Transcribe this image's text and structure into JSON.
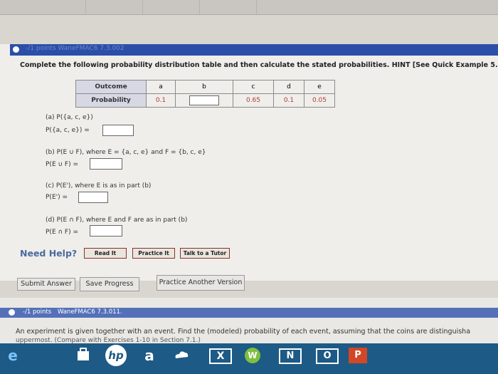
{
  "header": {
    "points_label": "-/1 points",
    "assignment_code": "WaneFMAC6 7.3.002"
  },
  "question": {
    "prompt": "Complete the following probability distribution table and then calculate the stated probabilities. HINT [See Quick Example 5.]",
    "table": {
      "outcome_label": "Outcome",
      "probability_label": "Probability",
      "outcomes": [
        "a",
        "b",
        "c",
        "d",
        "e"
      ],
      "probabilities": [
        "0.1",
        "",
        "0.65",
        "0.1",
        "0.05"
      ]
    },
    "parts": {
      "a": {
        "title": "(a)  P({a, c, e})",
        "label": "P({a, c, e}) ="
      },
      "b": {
        "title": "(b)  P(E ∪ F), where E = {a, c, e} and F = {b, c, e}",
        "label": "P(E ∪ F) ="
      },
      "c": {
        "title": "(c)  P(E'), where E is as in part (b)",
        "label": "P(E') ="
      },
      "d": {
        "title": "(d)  P(E ∩ F), where E and F are as in part (b)",
        "label": "P(E ∩ F) ="
      }
    }
  },
  "help": {
    "label": "Need Help?",
    "read_it": "Read It",
    "practice_it": "Practice It",
    "talk_to_tutor": "Talk to a Tutor"
  },
  "actions": {
    "submit": "Submit Answer",
    "save": "Save Progress",
    "another": "Practice Another Version"
  },
  "next_question": {
    "points_label": "-/1 points",
    "assignment_code": "WaneFMAC6 7.3.011.",
    "prompt": "An experiment is given together with an event. Find the (modeled) probability of each event, assuming that the coins are distinguisha",
    "prompt_line2": "uppermost. (Compare with Exercises 1-10 in Section 7.1.)"
  },
  "taskbar": {
    "hp_label": "hp",
    "amazon_label": "a",
    "excel_label": "X",
    "word_label": "W",
    "onenote_label": "N",
    "outlook_label": "O",
    "powerpoint_label": "P"
  },
  "colors": {
    "header_blue": "#2b4fa8",
    "taskbar_blue": "#1d5a86",
    "value_red": "#b03a3a",
    "help_blue": "#4a6aa0"
  }
}
